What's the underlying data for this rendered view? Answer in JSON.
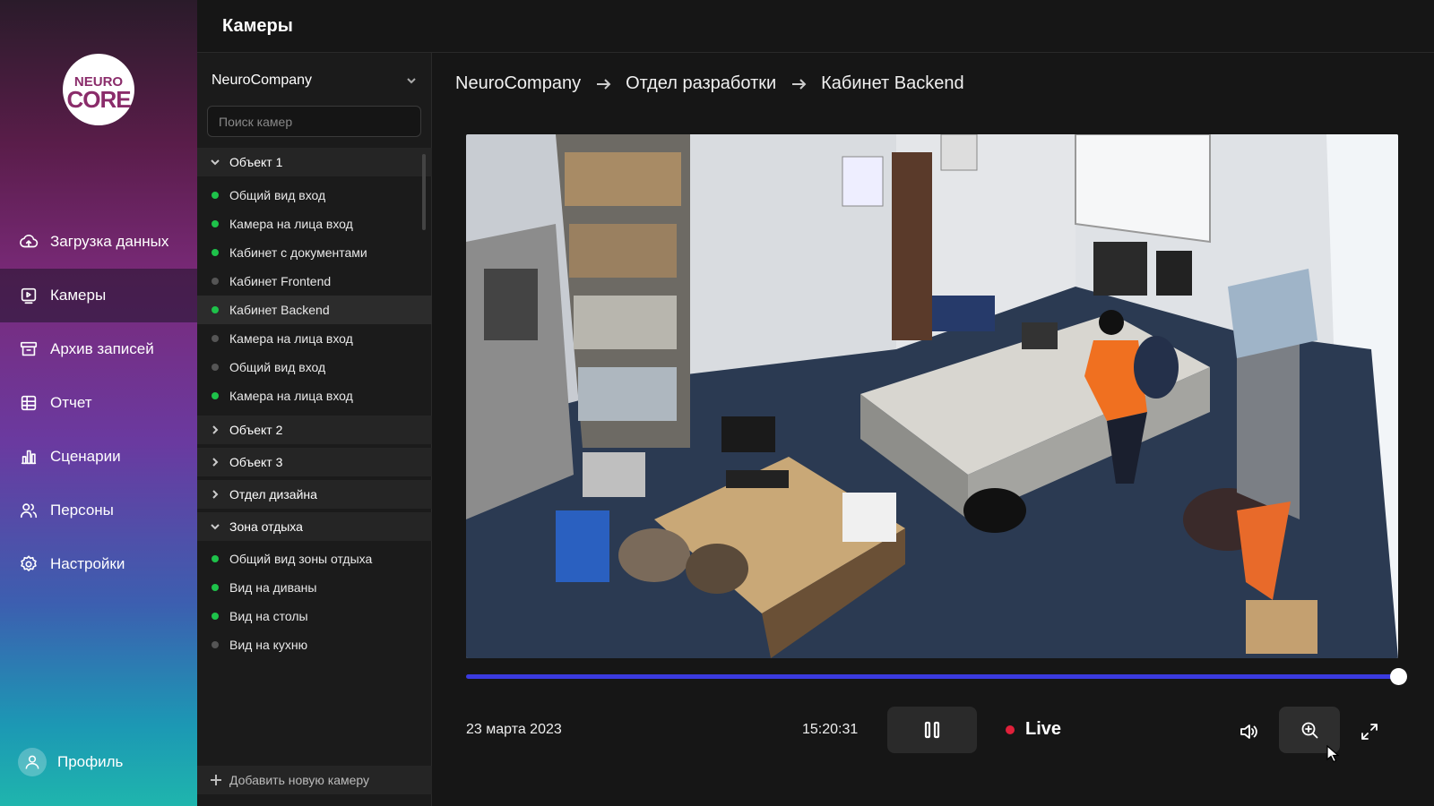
{
  "app": {
    "title": "Камеры",
    "logo_line1": "NEURO",
    "logo_line2": "CORE"
  },
  "sidebar": {
    "items": [
      {
        "label": "Загрузка данных",
        "icon": "cloud-upload-icon",
        "active": false
      },
      {
        "label": "Камеры",
        "icon": "camera-play-icon",
        "active": true
      },
      {
        "label": "Архив записей",
        "icon": "archive-icon",
        "active": false
      },
      {
        "label": "Отчет",
        "icon": "table-icon",
        "active": false
      },
      {
        "label": "Сценарии",
        "icon": "bar-chart-icon",
        "active": false
      },
      {
        "label": "Персоны",
        "icon": "people-icon",
        "active": false
      },
      {
        "label": "Настройки",
        "icon": "gear-icon",
        "active": false
      }
    ],
    "profile_label": "Профиль"
  },
  "tree": {
    "company": "NeuroCompany",
    "search_placeholder": "Поиск камер",
    "groups": [
      {
        "label": "Объект 1",
        "expanded": true,
        "cameras": [
          {
            "label": "Общий вид вход",
            "online": true
          },
          {
            "label": "Камера на лица вход",
            "online": true
          },
          {
            "label": "Кабинет с документами",
            "online": true
          },
          {
            "label": "Кабинет Frontend",
            "online": false
          },
          {
            "label": "Кабинет Backend",
            "online": true,
            "selected": true
          },
          {
            "label": "Камера на лица вход",
            "online": false
          },
          {
            "label": "Общий вид вход",
            "online": false
          },
          {
            "label": "Камера на лица вход",
            "online": true
          }
        ]
      },
      {
        "label": "Объект 2",
        "expanded": false
      },
      {
        "label": "Объект 3",
        "expanded": false
      },
      {
        "label": "Отдел дизайна",
        "expanded": false
      },
      {
        "label": "Зона отдыха",
        "expanded": true,
        "cameras": [
          {
            "label": "Общий вид зоны отдыха",
            "online": true
          },
          {
            "label": "Вид на диваны",
            "online": true
          },
          {
            "label": "Вид на столы",
            "online": true
          },
          {
            "label": "Вид на кухню",
            "online": false
          }
        ]
      }
    ],
    "add_camera_label": "Добавить новую камеру"
  },
  "breadcrumb": [
    "NeuroCompany",
    "Отдел разработки",
    "Кабинет Backend"
  ],
  "player": {
    "date": "23 марта 2023",
    "time": "15:20:31",
    "live_label": "Live",
    "progress": 1.0,
    "colors": {
      "progress": "#3a3ae0",
      "live_dot": "#e0203a",
      "online": "#1ec24a"
    }
  }
}
